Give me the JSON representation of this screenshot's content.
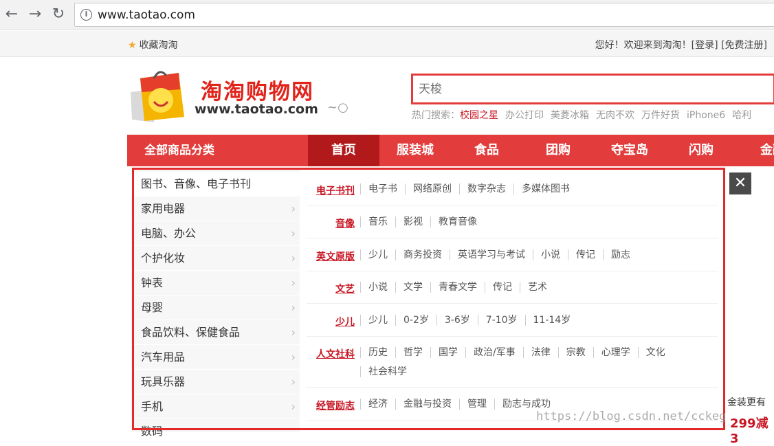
{
  "browser": {
    "url": "www.taotao.com"
  },
  "topbar": {
    "favorite": "收藏淘淘",
    "welcome": "您好！欢迎来到淘淘！",
    "login": "[登录]",
    "register": "[免费注册]"
  },
  "header": {
    "logo_title": "淘淘购物网",
    "logo_url": "www.taotao.com",
    "search_placeholder": "天梭",
    "hot_label": "热门搜索：",
    "hot_terms": [
      "校园之星",
      "办公打印",
      "美菱冰箱",
      "无肉不欢",
      "万件好货",
      "iPhone6",
      "哈利"
    ]
  },
  "nav": {
    "all_categories": "全部商品分类",
    "items": [
      "首页",
      "服装城",
      "食品",
      "团购",
      "夺宝岛",
      "闪购",
      "金融"
    ],
    "active": "首页"
  },
  "categories": [
    "图书、音像、电子书刊",
    "家用电器",
    "电脑、办公",
    "个护化妆",
    "钟表",
    "母婴",
    "食品饮料、保健食品",
    "汽车用品",
    "玩具乐器",
    "手机",
    "数码"
  ],
  "submenu": [
    {
      "head": "电子书刊",
      "links": [
        "电子书",
        "网络原创",
        "数字杂志",
        "多媒体图书"
      ]
    },
    {
      "head": "音像",
      "links": [
        "音乐",
        "影视",
        "教育音像"
      ]
    },
    {
      "head": "英文原版",
      "links": [
        "少儿",
        "商务投资",
        "英语学习与考试",
        "小说",
        "传记",
        "励志"
      ]
    },
    {
      "head": "文艺",
      "links": [
        "小说",
        "文学",
        "青春文学",
        "传记",
        "艺术"
      ]
    },
    {
      "head": "少儿",
      "links": [
        "少儿",
        "0-2岁",
        "3-6岁",
        "7-10岁",
        "11-14岁"
      ]
    },
    {
      "head": "人文社科",
      "links": [
        "历史",
        "哲学",
        "国学",
        "政治/军事",
        "法律",
        "宗教",
        "心理学",
        "文化",
        "社会科学"
      ]
    },
    {
      "head": "经管励志",
      "links": [
        "经济",
        "金融与投资",
        "管理",
        "励志与成功"
      ]
    }
  ],
  "side_ad": {
    "line1": "金装更有",
    "line2": "299减3"
  },
  "watermark": "https://blog.csdn.net/cckeg",
  "colors": {
    "brand_red": "#e23c3c",
    "nav_active": "#b1191a",
    "link_red": "#c81623"
  }
}
